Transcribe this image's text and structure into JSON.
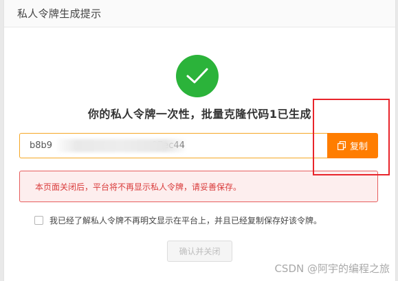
{
  "dialog": {
    "title": "私人令牌生成提示",
    "headline": "你的私人令牌一次性，批量克隆代码1已生成",
    "token_value": "b8b9                                   07ec44",
    "copy_label": "复制",
    "alert_text": "本页面关闭后，平台将不再显示私人令牌，请妥善保存。",
    "acknowledge_text": "我已经了解私人令牌不再明文显示在平台上，并且已经复制保存好该令牌。",
    "confirm_label": "确认并关闭"
  },
  "watermark": "CSDN @阿宇的编程之旅",
  "colors": {
    "success": "#2bb33a",
    "accent": "#ff7d00",
    "alert": "#d93b3b",
    "annotation": "#e8232a"
  },
  "icons": {
    "success": "check-icon",
    "copy": "copy-icon"
  }
}
